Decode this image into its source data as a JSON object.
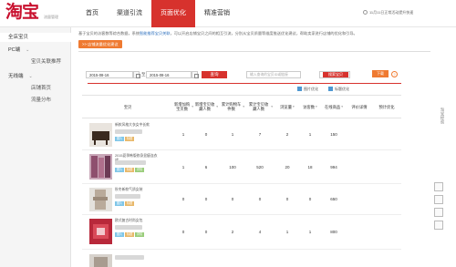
{
  "header": {
    "logo_text": "淘宝",
    "logo_sub": "流量管理",
    "nav": [
      "首页",
      "渠道引流",
      "页面优化",
      "精准营销"
    ],
    "active_nav": 2,
    "notice": "11月11日正常活动提升快速"
  },
  "sidebar": {
    "items": [
      {
        "label": "全店宝贝",
        "level": 1,
        "active": true
      },
      {
        "label": "PC端",
        "level": 1,
        "chevron": true
      },
      {
        "label": "宝贝关联推荐",
        "level": 2
      },
      {
        "label": "无线端",
        "level": 1,
        "chevron": true
      },
      {
        "label": "店铺首页",
        "level": 2
      },
      {
        "label": "流量分布",
        "level": 2
      }
    ]
  },
  "content": {
    "tip_prefix": "基于宝贝的访客数等综合数据，系统",
    "tip_link": "智能推荐宝贝关联",
    "tip_suffix": "，可以开启店铺宝贝之间的相互引流，分别从宝贝质量等维度推送优化建议，帮助卖家进行店铺的优化和引导。",
    "orange_button": ">> 店铺流量优化建议",
    "date_from": "2015-08-16",
    "date_to": "2015-08-16",
    "date_sep": "至",
    "query_button": "查询",
    "search_placeholder": "输入查询的宝贝ID或链接",
    "search_button": "搜索宝贝",
    "legend": [
      {
        "label": "图片优化"
      },
      {
        "label": "标题优化"
      }
    ],
    "download_button": "下载",
    "help_label": "?"
  },
  "table": {
    "headers": [
      "宝贝",
      "新增加购宝贝数",
      "新增宝贝收藏人数",
      "累计购物车件数",
      "累计宝贝收藏人数",
      "浏览量",
      "访客数",
      "在线商品",
      "评价详情",
      "预计优化"
    ],
    "rows": [
      {
        "name": "新款风格大衣女中长款",
        "values": [
          "1",
          "0",
          "1",
          "7",
          "2",
          "1",
          "150",
          "",
          ""
        ],
        "tags": [
          "图片",
          "标题"
        ]
      },
      {
        "name": "2015夏季韩版修身显瘦连衣裙",
        "values": [
          "1",
          "6",
          "100",
          "520",
          "20",
          "18",
          "994",
          "",
          ""
        ],
        "tags": [
          "图片",
          "标题",
          "详情"
        ]
      },
      {
        "name": "秋冬新款气质女装",
        "values": [
          "0",
          "0",
          "0",
          "0",
          "0",
          "0",
          "650",
          "",
          ""
        ],
        "tags": [
          "图片",
          "标题"
        ]
      },
      {
        "name": "欧式复古时尚女包",
        "values": [
          "0",
          "0",
          "2",
          "4",
          "1",
          "1",
          "800",
          "",
          ""
        ],
        "tags": [
          "图片",
          "标题",
          "详情"
        ]
      },
      {
        "name": "",
        "values": [
          "",
          "",
          "",
          "",
          "",
          "",
          "",
          "",
          ""
        ],
        "tags": []
      }
    ]
  },
  "side_text": "淘宝经验",
  "colors": {
    "brand_red": "#d7322d",
    "orange": "#ef7a31",
    "link_blue": "#2d6fbd"
  }
}
